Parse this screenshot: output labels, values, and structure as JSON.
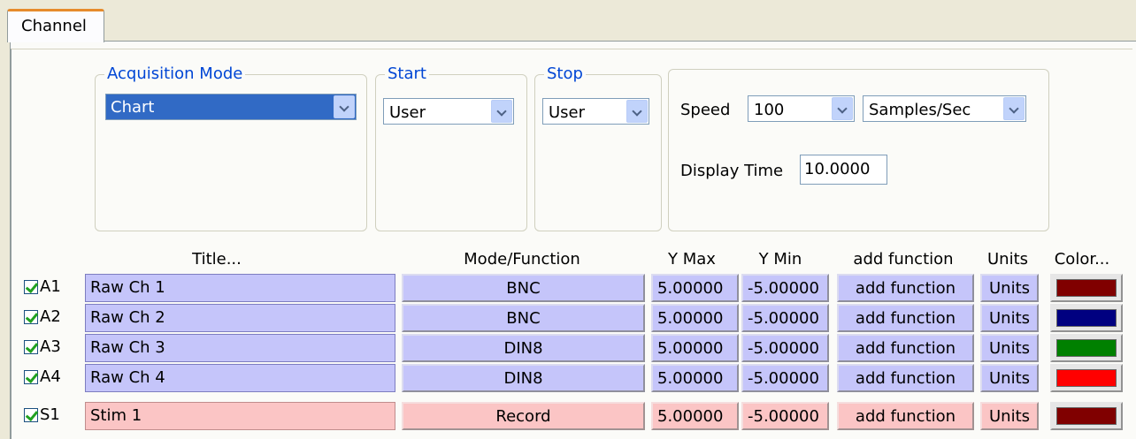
{
  "tab": {
    "label": "Channel"
  },
  "acquisition": {
    "legend": "Acquisition Mode",
    "value": "Chart"
  },
  "start": {
    "legend": "Start",
    "value": "User"
  },
  "stop": {
    "legend": "Stop",
    "value": "User"
  },
  "speed": {
    "label": "Speed",
    "value": "100",
    "unit": "Samples/Sec"
  },
  "display_time": {
    "label": "Display Time",
    "value": "10.0000"
  },
  "headers": {
    "title": "Title...",
    "mode": "Mode/Function",
    "ymax": "Y Max",
    "ymin": "Y Min",
    "func": "add function",
    "units": "Units",
    "color": "Color..."
  },
  "channels": [
    {
      "id": "A1",
      "title": "Raw Ch 1",
      "mode": "BNC",
      "ymax": "5.00000",
      "ymin": "-5.00000",
      "func": "add function",
      "units": "Units",
      "color": "#800000",
      "checked": true
    },
    {
      "id": "A2",
      "title": "Raw Ch 2",
      "mode": "BNC",
      "ymax": "5.00000",
      "ymin": "-5.00000",
      "func": "add function",
      "units": "Units",
      "color": "#000080",
      "checked": true
    },
    {
      "id": "A3",
      "title": "Raw Ch 3",
      "mode": "DIN8",
      "ymax": "5.00000",
      "ymin": "-5.00000",
      "func": "add function",
      "units": "Units",
      "color": "#008000",
      "checked": true
    },
    {
      "id": "A4",
      "title": "Raw Ch 4",
      "mode": "DIN8",
      "ymax": "5.00000",
      "ymin": "-5.00000",
      "func": "add function",
      "units": "Units",
      "color": "#ff0000",
      "checked": true
    },
    {
      "id": "S1",
      "title": "Stim 1",
      "mode": "Record",
      "ymax": "5.00000",
      "ymin": "-5.00000",
      "func": "add function",
      "units": "Units",
      "color": "#800000",
      "checked": true
    }
  ]
}
